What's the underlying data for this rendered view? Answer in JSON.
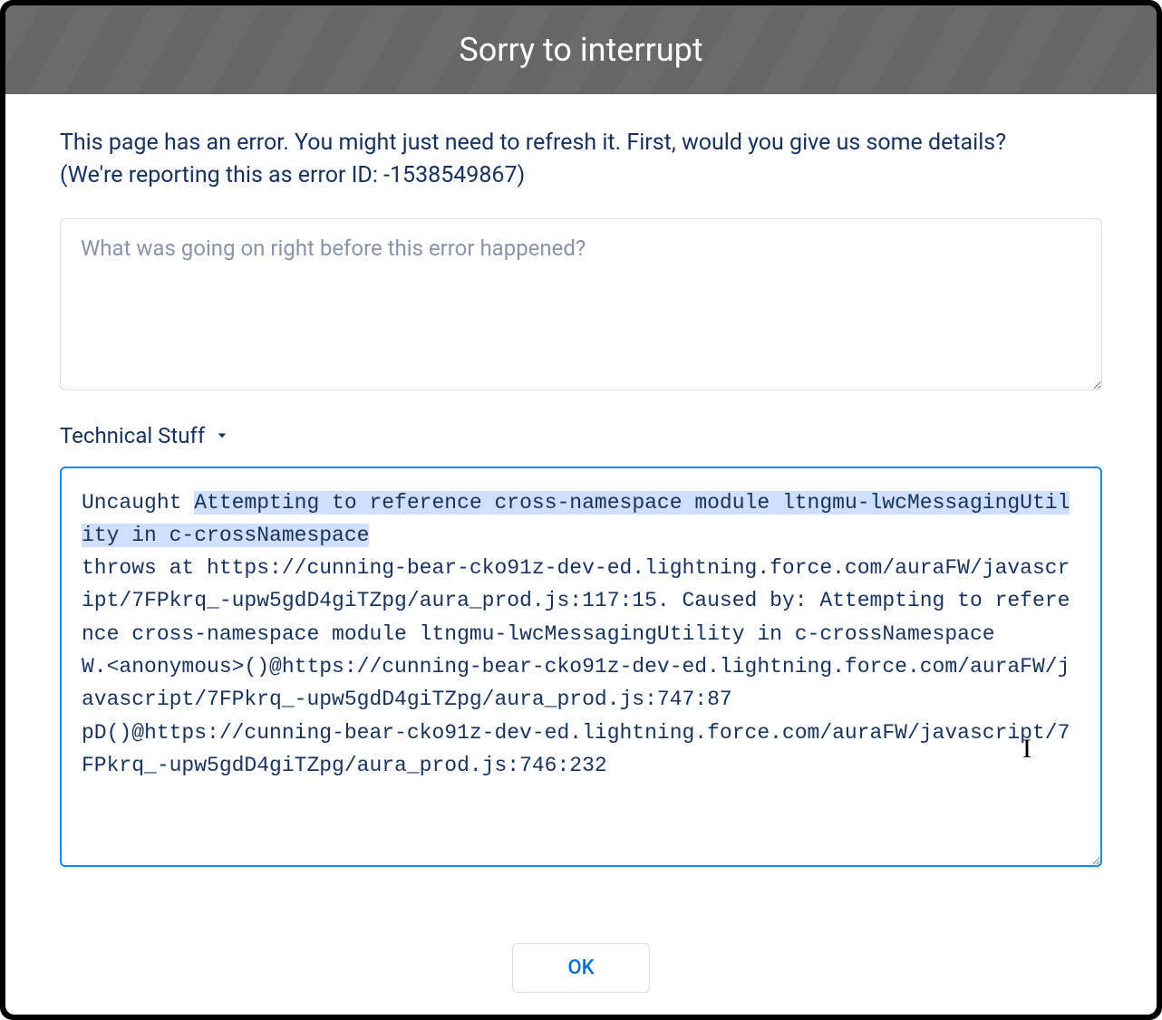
{
  "header": {
    "title": "Sorry to interrupt"
  },
  "body": {
    "error_prompt_line1": "This page has an error. You might just need to refresh it. First, would you give us some details?",
    "error_prompt_line2": "(We're reporting this as error ID: -1538549867)",
    "feedback_placeholder": "What was going on right before this error happened?",
    "technical_toggle_label": "Technical Stuff",
    "technical_prefix": "Uncaught ",
    "technical_highlighted": "Attempting to reference cross-namespace module ltngmu-lwcMessagingUtility in c-crossNamespace",
    "technical_rest": "\nthrows at https://cunning-bear-cko91z-dev-ed.lightning.force.com/auraFW/javascript/7FPkrq_-upw5gdD4giTZpg/aura_prod.js:117:15. Caused by: Attempting to reference cross-namespace module ltngmu-lwcMessagingUtility in c-crossNamespace\nW.<anonymous>()@https://cunning-bear-cko91z-dev-ed.lightning.force.com/auraFW/javascript/7FPkrq_-upw5gdD4giTZpg/aura_prod.js:747:87\npD()@https://cunning-bear-cko91z-dev-ed.lightning.force.com/auraFW/javascript/7FPkrq_-upw5gdD4giTZpg/aura_prod.js:746:232"
  },
  "footer": {
    "ok_label": "OK"
  }
}
